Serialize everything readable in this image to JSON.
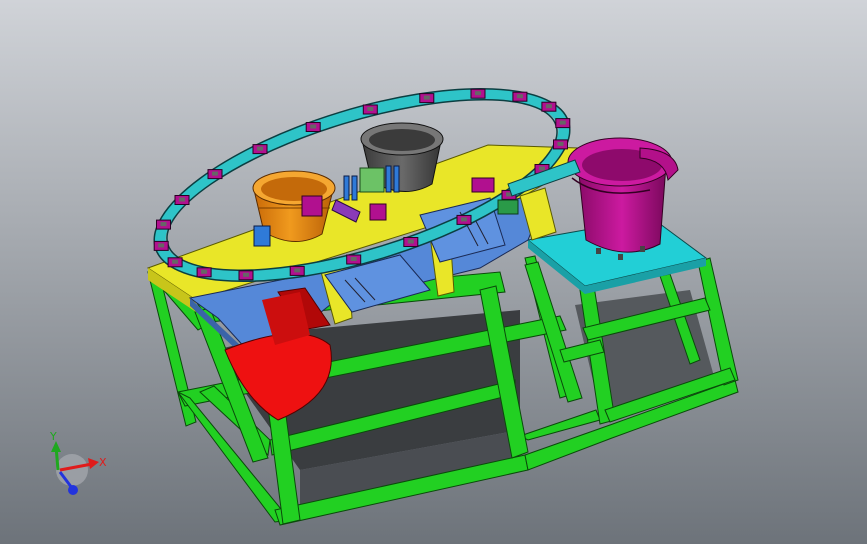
{
  "viewport": {
    "background_top": "#d0d3d8",
    "background_bottom": "#6d737a"
  },
  "model": {
    "frame_color": "#22d022",
    "table_top_color": "#e9e628",
    "plate_color": "#5588d8",
    "hopper_color": "#ee1111",
    "left_bowl_color": "#ee8811",
    "center_bowl_color": "#555555",
    "right_bowl_color": "#bb0f90",
    "side_table_color": "#22cfd6",
    "conveyor_color": "#2ec4c8",
    "fixture_color": "#b1108f"
  },
  "triad": {
    "x_label": "X",
    "y_label": "Y",
    "x_color": "#e01b1b",
    "y_color": "#1fa81f",
    "z_color": "#2233dd"
  }
}
